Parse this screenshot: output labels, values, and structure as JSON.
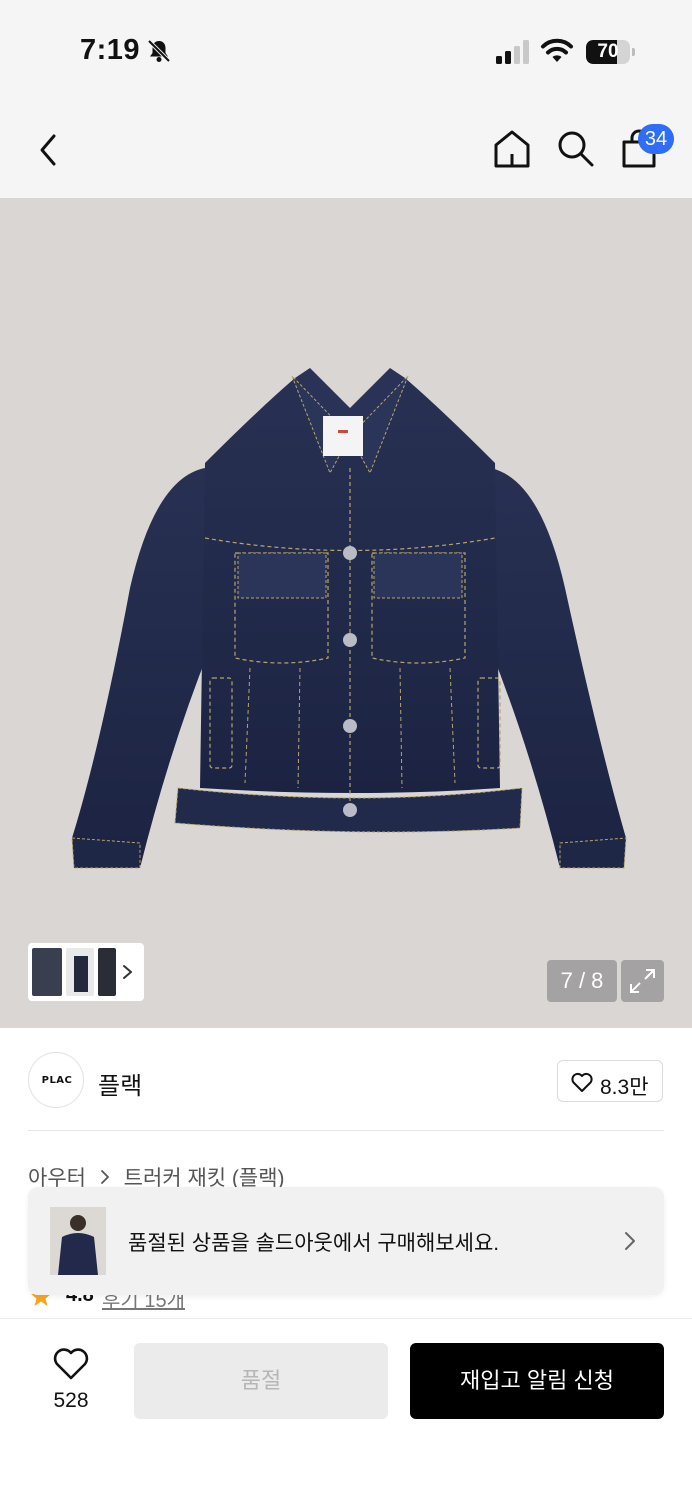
{
  "status_bar": {
    "time": "7:19",
    "battery_level": "70",
    "battery_fraction": 0.7
  },
  "header": {
    "cart_count": "34",
    "icons": [
      "back-icon",
      "home-icon",
      "search-icon",
      "shopping-bag-icon"
    ]
  },
  "gallery": {
    "page_indicator": "7 / 8",
    "current_index": 7,
    "total": 8
  },
  "brand": {
    "logo_text": "PLAC",
    "name": "플랙",
    "likes": "8.3만"
  },
  "breadcrumb": {
    "category": "아우터",
    "product": "트러커 재킷 (플랙)"
  },
  "rating": {
    "value": "4.8",
    "reviews": "후기 15개"
  },
  "soldout_banner": {
    "text": "품절된 상품을 솔드아웃에서 구매해보세요."
  },
  "bottom_bar": {
    "wish_count": "528",
    "soldout_label": "품절",
    "restock_label": "재입고 알림 신청"
  },
  "colors": {
    "badge": "#2f6df6",
    "denim": "#22294a",
    "restock_button": "#000000",
    "soldout_button": "#ebebeb",
    "rating_star": "#f5a623"
  }
}
